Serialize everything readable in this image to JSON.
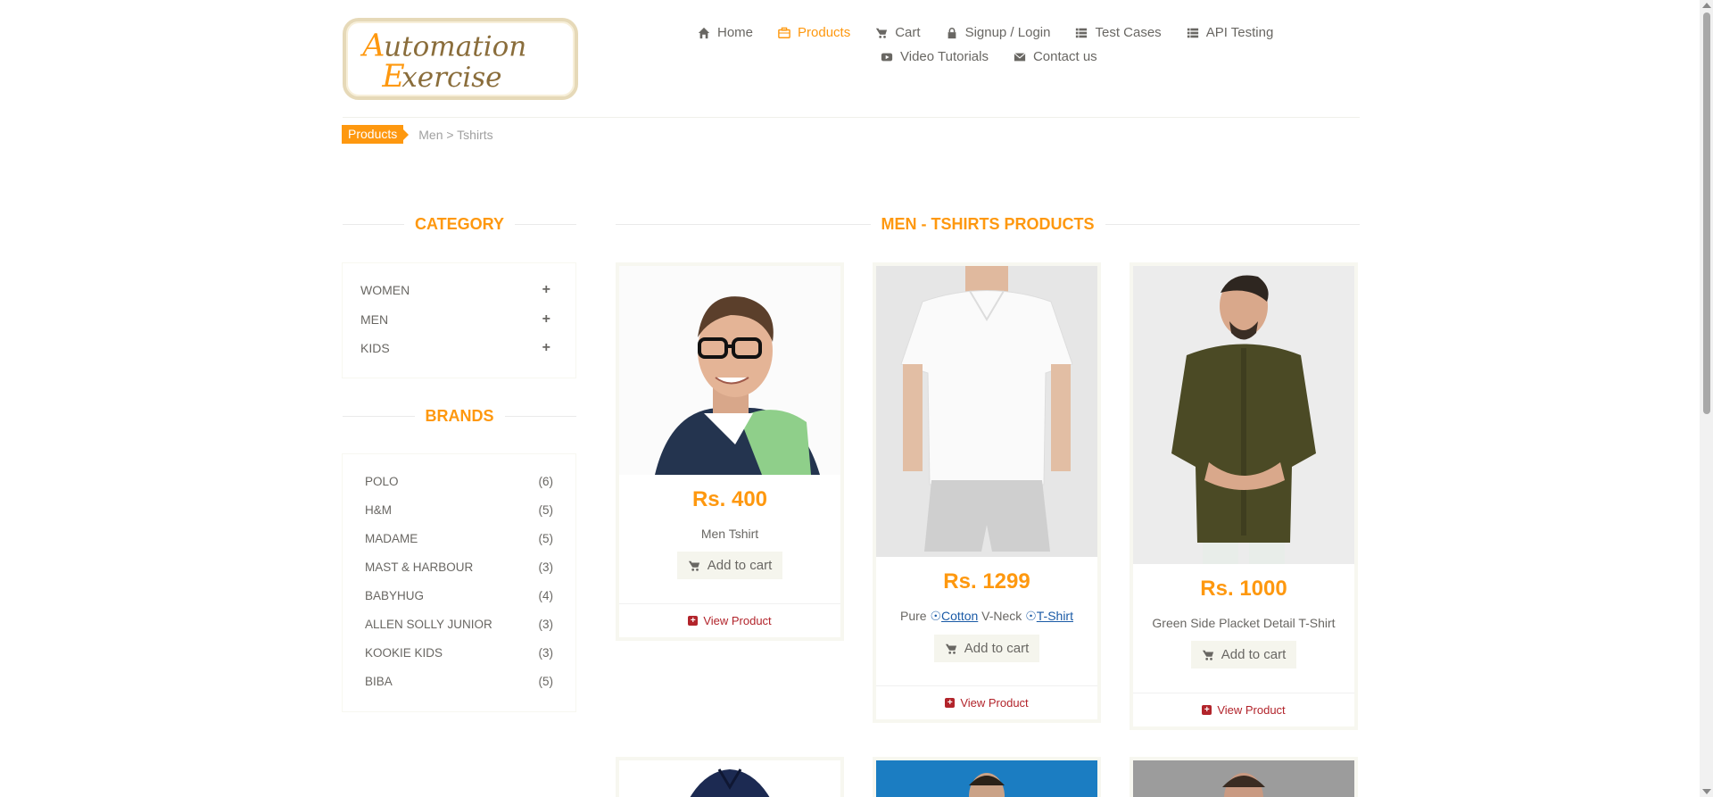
{
  "logo": {
    "line1": "Automation",
    "line2": "Exercise"
  },
  "nav": [
    {
      "label": "Home",
      "icon": "home-icon",
      "active": false
    },
    {
      "label": "Products",
      "icon": "briefcase-icon",
      "active": true
    },
    {
      "label": "Cart",
      "icon": "cart-icon",
      "active": false
    },
    {
      "label": "Signup / Login",
      "icon": "lock-icon",
      "active": false
    },
    {
      "label": "Test Cases",
      "icon": "list-icon",
      "active": false
    },
    {
      "label": "API Testing",
      "icon": "list-icon",
      "active": false
    },
    {
      "label": "Video Tutorials",
      "icon": "youtube-icon",
      "active": false
    },
    {
      "label": "Contact us",
      "icon": "envelope-icon",
      "active": false
    }
  ],
  "breadcrumb": {
    "active": "Products",
    "rest": "Men > Tshirts"
  },
  "sidebar": {
    "category_title": "Category",
    "categories": [
      {
        "label": "Women",
        "toggle": "+"
      },
      {
        "label": "Men",
        "toggle": "+"
      },
      {
        "label": "Kids",
        "toggle": "+"
      }
    ],
    "brands_title": "Brands",
    "brands": [
      {
        "name": "POLO",
        "count": "(6)"
      },
      {
        "name": "H&M",
        "count": "(5)"
      },
      {
        "name": "MADAME",
        "count": "(5)"
      },
      {
        "name": "MAST & HARBOUR",
        "count": "(3)"
      },
      {
        "name": "BABYHUG",
        "count": "(4)"
      },
      {
        "name": "ALLEN SOLLY JUNIOR",
        "count": "(3)"
      },
      {
        "name": "KOOKIE KIDS",
        "count": "(3)"
      },
      {
        "name": "BIBA",
        "count": "(5)"
      }
    ]
  },
  "main": {
    "title": "Men - Tshirts Products",
    "add_to_cart": "Add to cart",
    "view_product": "View Product",
    "products": [
      {
        "price": "Rs. 400",
        "name": "Men Tshirt"
      },
      {
        "price": "Rs. 1299",
        "name_parts": [
          "Pure",
          "Cotton",
          "V-Neck",
          "T-Shirt"
        ]
      },
      {
        "price": "Rs. 1000",
        "name": "Green Side Placket Detail T-Shirt"
      }
    ]
  },
  "colors": {
    "accent": "#fe980f",
    "text": "#696763",
    "view_link": "#b2242b"
  }
}
